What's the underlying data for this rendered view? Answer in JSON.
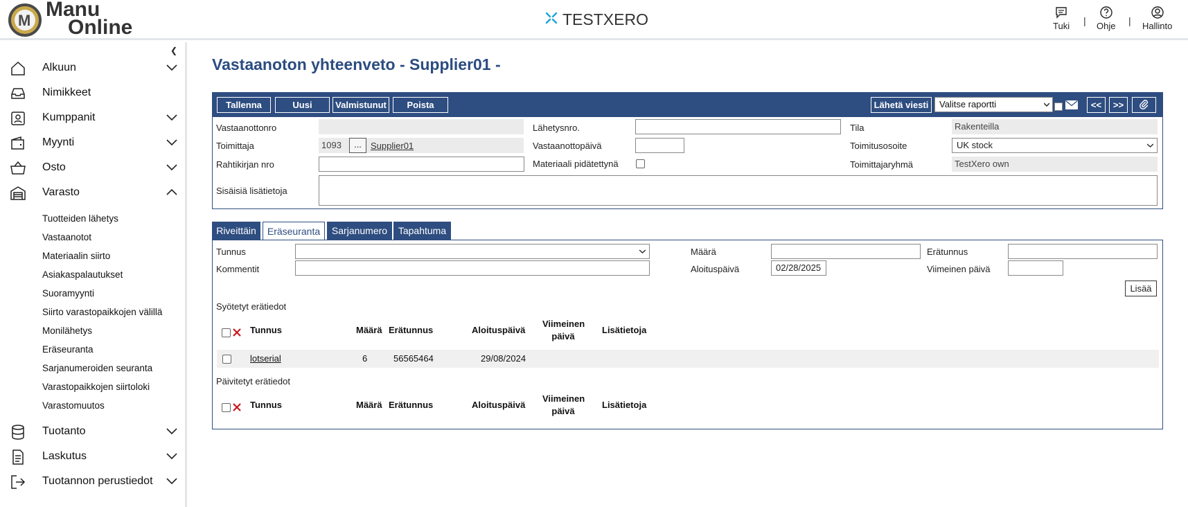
{
  "header": {
    "logo_line1": "Manu",
    "logo_line2": "Online",
    "brand": "TESTXERO",
    "links": [
      {
        "label": "Tuki",
        "icon": "chat-icon"
      },
      {
        "label": "Ohje",
        "icon": "help-icon"
      },
      {
        "label": "Hallinto",
        "icon": "user-icon"
      }
    ],
    "separator": "|"
  },
  "sidebar": {
    "items": [
      {
        "label": "Alkuun",
        "icon": "home-icon",
        "expandable": true
      },
      {
        "label": "Nimikkeet",
        "icon": "inbox-icon",
        "expandable": false
      },
      {
        "label": "Kumppanit",
        "icon": "partner-icon",
        "expandable": true
      },
      {
        "label": "Myynti",
        "icon": "wallet-icon",
        "expandable": true
      },
      {
        "label": "Osto",
        "icon": "basket-icon",
        "expandable": true
      },
      {
        "label": "Varasto",
        "icon": "warehouse-icon",
        "expandable": true,
        "expanded": true
      },
      {
        "label": "Tuotanto",
        "icon": "database-icon",
        "expandable": true
      },
      {
        "label": "Laskutus",
        "icon": "document-icon",
        "expandable": true
      },
      {
        "label": "Tuotannon perustiedot",
        "icon": "exit-icon",
        "expandable": true
      }
    ],
    "subitems": [
      "Tuotteiden lähetys",
      "Vastaanotot",
      "Materiaalin siirto",
      "Asiakaspalautukset",
      "Suoramyynti",
      "Siirto varastopaikkojen välillä",
      "Monilähetys",
      "Eräseuranta",
      "Sarjanumeroiden seuranta",
      "Varastopaikkojen siirtoloki",
      "Varastomuutos"
    ]
  },
  "page": {
    "title": "Vastaanoton yhteenveto - Supplier01 -"
  },
  "toolbar": {
    "save": "Tallenna",
    "new": "Uusi",
    "done": "Valmistunut",
    "delete": "Poista",
    "send_message": "Lähetä viesti",
    "report_select": "Valitse raportti",
    "prev": "<<",
    "next": ">>"
  },
  "form": {
    "receipt_no_label": "Vastaanottonro",
    "receipt_no_value": "",
    "supplier_label": "Toimittaja",
    "supplier_code": "1093",
    "supplier_browse": "...",
    "supplier_name": "Supplier01",
    "waybill_label": "Rahtikirjan nro",
    "waybill_value": "",
    "internal_info_label": "Sisäisiä lisätietoja",
    "internal_info_value": "",
    "dispatch_no_label": "Lähetysnro.",
    "dispatch_no_value": "",
    "receipt_date_label": "Vastaanottopäivä",
    "receipt_date_value": "",
    "material_held_label": "Materiaali pidätettynä",
    "status_label": "Tila",
    "status_value": "Rakenteilla",
    "delivery_address_label": "Toimitusosoite",
    "delivery_address_value": "UK stock",
    "supplier_group_label": "Toimittajaryhmä",
    "supplier_group_value": "TestXero own"
  },
  "tabs": [
    {
      "label": "Riveittäin",
      "active": false
    },
    {
      "label": "Eräseuranta",
      "active": true
    },
    {
      "label": "Sarjanumero",
      "active": false
    },
    {
      "label": "Tapahtuma",
      "active": false
    }
  ],
  "batch": {
    "id_label": "Tunnus",
    "id_value": "",
    "comment_label": "Kommentit",
    "comment_value": "",
    "qty_label": "Määrä",
    "qty_value": "",
    "start_label": "Aloituspäivä",
    "start_value": "02/28/2025",
    "batch_id_label": "Erätunnus",
    "batch_id_value": "",
    "last_day_label": "Viimeinen päivä",
    "last_day_value": "",
    "add_button": "Lisää",
    "entered_title": "Syötetyt erätiedot",
    "updated_title": "Päivitetyt erätiedot",
    "columns": [
      "Tunnus",
      "Määrä",
      "Erätunnus",
      "Aloituspäivä",
      "Viimeinen päivä",
      "Lisätietoja"
    ],
    "col_last_day_1": "Viimeinen",
    "col_last_day_2": "päivä",
    "rows": [
      {
        "id": "lotserial",
        "qty": "6",
        "batch_id": "56565464",
        "start": "29/08/2024",
        "last_day": "",
        "info": ""
      }
    ]
  }
}
